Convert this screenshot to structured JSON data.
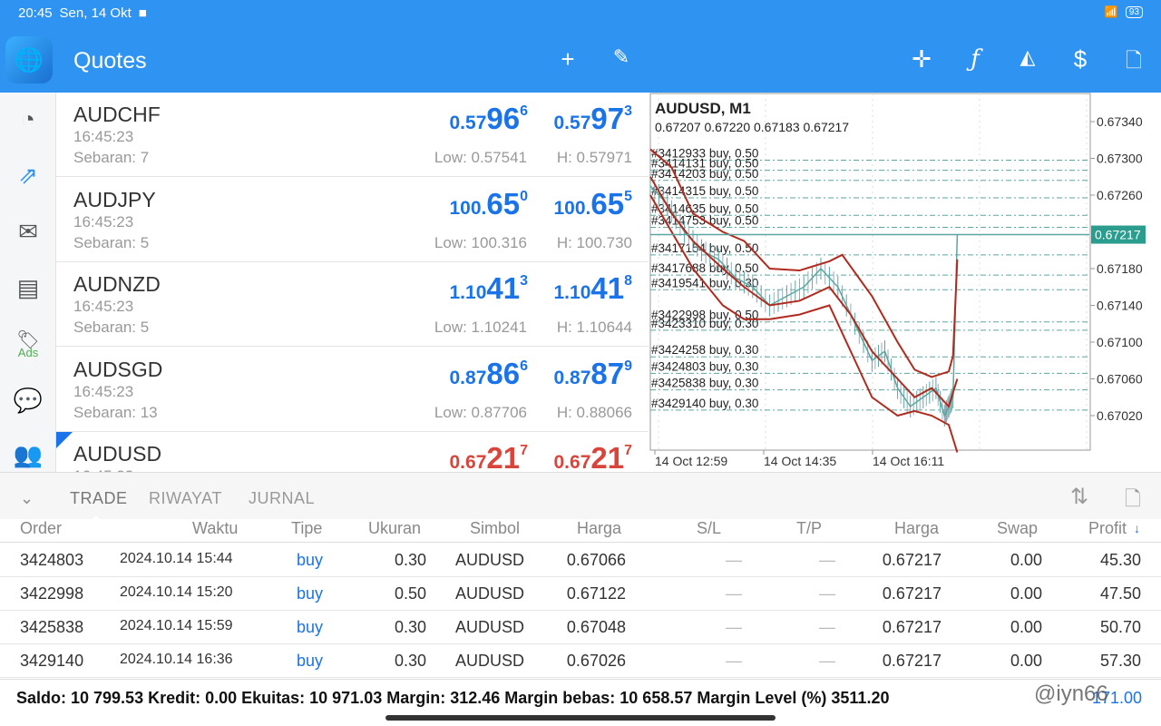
{
  "status": {
    "time": "20:45",
    "date": "Sen, 14 Okt",
    "battery": "93"
  },
  "header": {
    "title": "Quotes"
  },
  "quotes": [
    {
      "symbol": "AUDCHF",
      "time": "16:45:23",
      "spread": "Sebaran: 7",
      "bid_pre": "0.57",
      "bid_big": "96",
      "bid_sup": "6",
      "ask_pre": "0.57",
      "ask_big": "97",
      "ask_sup": "3",
      "low": "Low: 0.57541",
      "high": "H: 0.57971",
      "color": "blue"
    },
    {
      "symbol": "AUDJPY",
      "time": "16:45:23",
      "spread": "Sebaran: 5",
      "bid_pre": "100.",
      "bid_big": "65",
      "bid_sup": "0",
      "ask_pre": "100.",
      "ask_big": "65",
      "ask_sup": "5",
      "low": "Low: 100.316",
      "high": "H: 100.730",
      "color": "blue"
    },
    {
      "symbol": "AUDNZD",
      "time": "16:45:23",
      "spread": "Sebaran: 5",
      "bid_pre": "1.10",
      "bid_big": "41",
      "bid_sup": "3",
      "ask_pre": "1.10",
      "ask_big": "41",
      "ask_sup": "8",
      "low": "Low: 1.10241",
      "high": "H: 1.10644",
      "color": "blue"
    },
    {
      "symbol": "AUDSGD",
      "time": "16:45:23",
      "spread": "Sebaran: 13",
      "bid_pre": "0.87",
      "bid_big": "86",
      "bid_sup": "6",
      "ask_pre": "0.87",
      "ask_big": "87",
      "ask_sup": "9",
      "low": "Low: 0.87706",
      "high": "H: 0.88066",
      "color": "blue"
    },
    {
      "symbol": "AUDUSD",
      "time": "16:45:23",
      "spread": "",
      "bid_pre": "0.67",
      "bid_big": "21",
      "bid_sup": "7",
      "ask_pre": "0.67",
      "ask_big": "21",
      "ask_sup": "7",
      "low": "",
      "high": "",
      "color": "red"
    }
  ],
  "chart": {
    "title": "AUDUSD, M1",
    "ohlc": "0.67207 0.67220 0.67183 0.67217",
    "current_price": "0.67217",
    "current": 0.67217,
    "y_ticks": [
      "0.67340",
      "0.67300",
      "0.67260",
      "0.67180",
      "0.67140",
      "0.67100",
      "0.67060",
      "0.67020"
    ],
    "x_ticks": [
      "14 Oct 12:59",
      "14 Oct 14:35",
      "14 Oct 16:11"
    ],
    "orders": [
      {
        "label": "#3412933 buy, 0.50",
        "price": 0.67298
      },
      {
        "label": "#3414131 buy, 0.50",
        "price": 0.67287
      },
      {
        "label": "#3414203 buy, 0.50",
        "price": 0.67276
      },
      {
        "label": "#3414315 buy, 0.50",
        "price": 0.67257
      },
      {
        "label": "#3414635 buy, 0.50",
        "price": 0.67238
      },
      {
        "label": "#3414753 buy, 0.50",
        "price": 0.67225
      },
      {
        "label": "#3417154 buy, 0.50",
        "price": 0.67195
      },
      {
        "label": "#3417688 buy, 0.50",
        "price": 0.67173
      },
      {
        "label": "#3419541 buy, 0.30",
        "price": 0.67157
      },
      {
        "label": "#3422998 buy, 0.50",
        "price": 0.67122
      },
      {
        "label": "#3423310 buy, 0.30",
        "price": 0.67113
      },
      {
        "label": "#3424258 buy, 0.30",
        "price": 0.67084
      },
      {
        "label": "#3424803 buy, 0.30",
        "price": 0.67066
      },
      {
        "label": "#3425838 buy, 0.30",
        "price": 0.67048
      },
      {
        "label": "#3429140 buy, 0.30",
        "price": 0.67026
      }
    ],
    "upper": [
      [
        0,
        0.6731
      ],
      [
        5,
        0.6729
      ],
      [
        10,
        0.6724
      ],
      [
        17,
        0.6722
      ],
      [
        22,
        0.6721
      ],
      [
        28,
        0.6718
      ],
      [
        35,
        0.67178
      ],
      [
        42,
        0.67188
      ],
      [
        45,
        0.67195
      ],
      [
        52,
        0.6715
      ],
      [
        58,
        0.671
      ],
      [
        62,
        0.6707
      ],
      [
        66,
        0.67062
      ],
      [
        70,
        0.67068
      ],
      [
        71,
        0.67085
      ],
      [
        72,
        0.6719
      ]
    ],
    "middle": [
      [
        0,
        0.6728
      ],
      [
        5,
        0.6724
      ],
      [
        10,
        0.6721
      ],
      [
        17,
        0.6718
      ],
      [
        22,
        0.6716
      ],
      [
        28,
        0.6714
      ],
      [
        35,
        0.67145
      ],
      [
        42,
        0.6716
      ],
      [
        47,
        0.6713
      ],
      [
        52,
        0.6709
      ],
      [
        58,
        0.6706
      ],
      [
        62,
        0.6704
      ],
      [
        66,
        0.6705
      ],
      [
        70,
        0.6703
      ],
      [
        72,
        0.6706
      ]
    ],
    "lower": [
      [
        0,
        0.6726
      ],
      [
        5,
        0.6722
      ],
      [
        10,
        0.6718
      ],
      [
        17,
        0.6714
      ],
      [
        22,
        0.67125
      ],
      [
        28,
        0.67125
      ],
      [
        35,
        0.6713
      ],
      [
        42,
        0.6714
      ],
      [
        47,
        0.6709
      ],
      [
        52,
        0.6704
      ],
      [
        58,
        0.6702
      ],
      [
        62,
        0.67025
      ],
      [
        66,
        0.6702
      ],
      [
        70,
        0.6701
      ],
      [
        72,
        0.6698
      ]
    ],
    "price": [
      [
        0,
        0.6727
      ],
      [
        4,
        0.6725
      ],
      [
        8,
        0.6722
      ],
      [
        12,
        0.672
      ],
      [
        16,
        0.6719
      ],
      [
        20,
        0.6717
      ],
      [
        24,
        0.6716
      ],
      [
        28,
        0.6714
      ],
      [
        32,
        0.6715
      ],
      [
        36,
        0.6716
      ],
      [
        40,
        0.6718
      ],
      [
        44,
        0.6716
      ],
      [
        48,
        0.6712
      ],
      [
        52,
        0.6708
      ],
      [
        55,
        0.6709
      ],
      [
        58,
        0.6705
      ],
      [
        61,
        0.6703
      ],
      [
        64,
        0.6704
      ],
      [
        67,
        0.6705
      ],
      [
        69,
        0.6702
      ],
      [
        70,
        0.6703
      ],
      [
        71,
        0.6704
      ],
      [
        72,
        0.67217
      ]
    ]
  },
  "tabs": [
    "TRADE",
    "RIWAYAT",
    "JURNAL"
  ],
  "table": {
    "headers": [
      "Order",
      "Waktu",
      "Tipe",
      "Ukuran",
      "Simbol",
      "Harga",
      "S/L",
      "T/P",
      "Harga",
      "Swap",
      "Profit"
    ],
    "rows": [
      [
        "3424803",
        "2024.10.14 15:44",
        "buy",
        "0.30",
        "AUDUSD",
        "0.67066",
        "—",
        "—",
        "0.67217",
        "0.00",
        "45.30"
      ],
      [
        "3422998",
        "2024.10.14 15:20",
        "buy",
        "0.50",
        "AUDUSD",
        "0.67122",
        "—",
        "—",
        "0.67217",
        "0.00",
        "47.50"
      ],
      [
        "3425838",
        "2024.10.14 15:59",
        "buy",
        "0.30",
        "AUDUSD",
        "0.67048",
        "—",
        "—",
        "0.67217",
        "0.00",
        "50.70"
      ],
      [
        "3429140",
        "2024.10.14 16:36",
        "buy",
        "0.30",
        "AUDUSD",
        "0.67026",
        "—",
        "—",
        "0.67217",
        "0.00",
        "57.30"
      ]
    ]
  },
  "footer": {
    "text": "Saldo: 10 799.53  Kredit: 0.00  Ekuitas: 10 971.03  Margin: 312.46  Margin bebas: 10 658.57  Margin Level (%)  3511.20",
    "total": "171.00",
    "watermark": "@iyn66"
  }
}
